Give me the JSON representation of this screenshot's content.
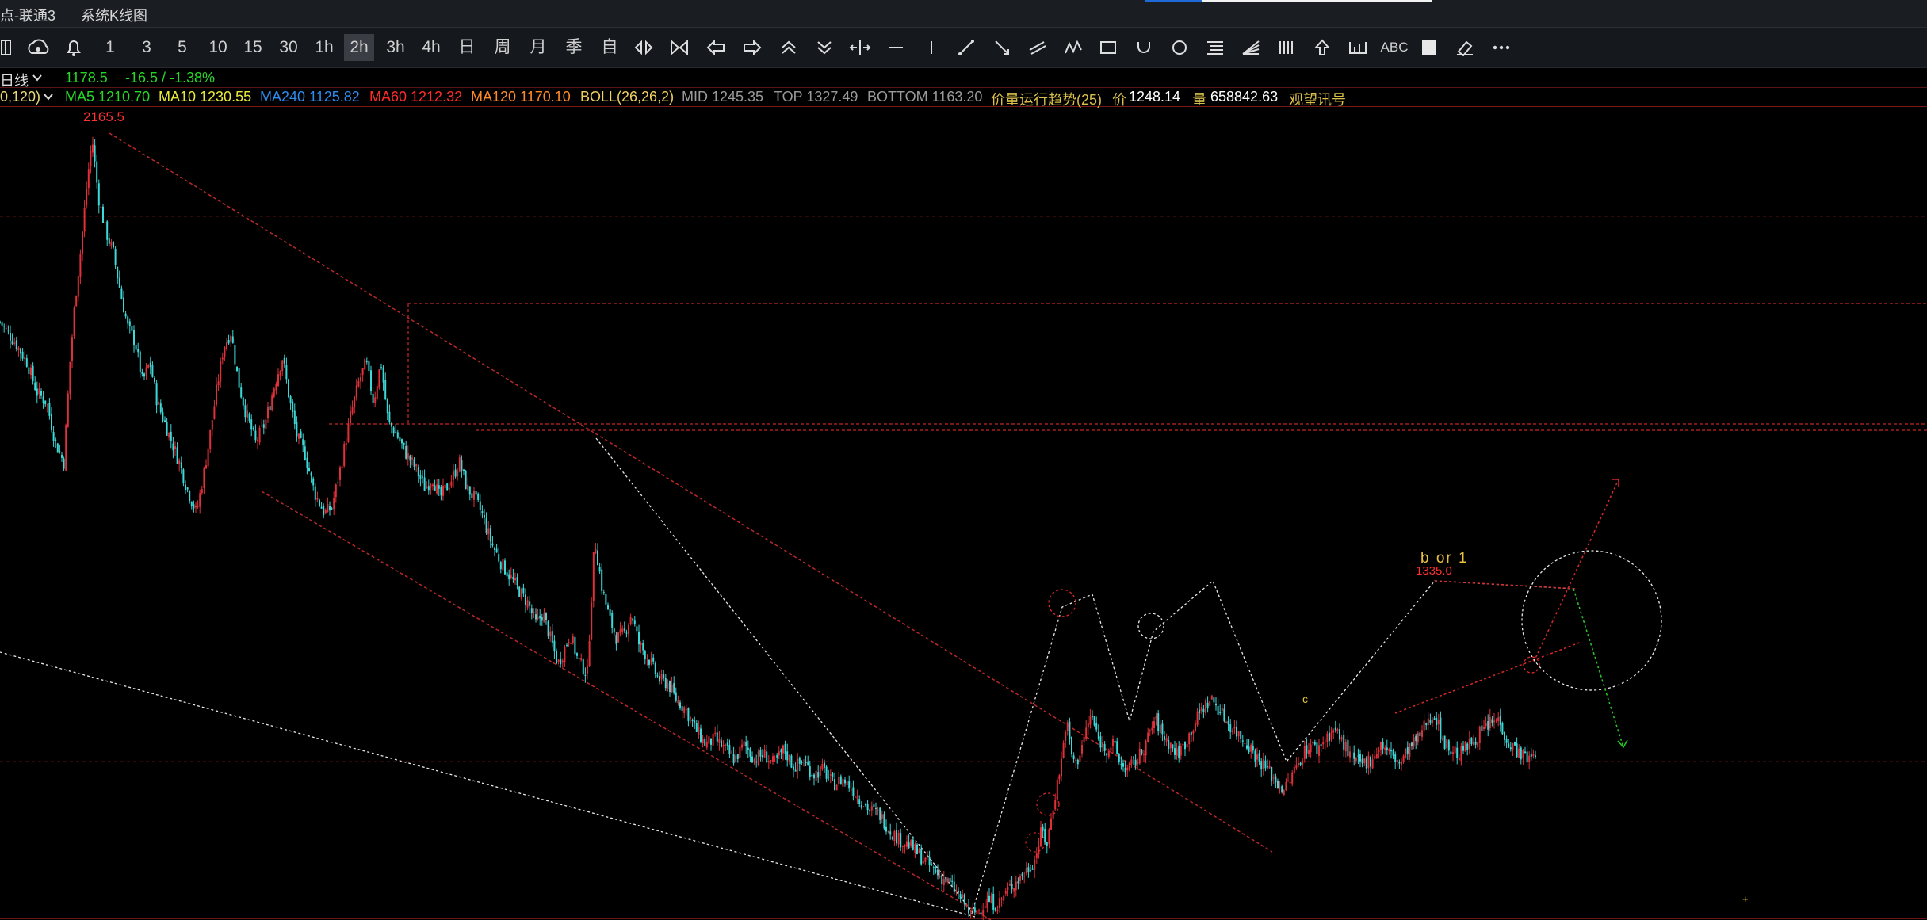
{
  "window": {
    "title_1": "点-联通3",
    "title_2": "系统K线图"
  },
  "toolbar": {
    "periods": [
      {
        "name": "period-1m",
        "label": "1"
      },
      {
        "name": "period-3m",
        "label": "3"
      },
      {
        "name": "period-5m",
        "label": "5"
      },
      {
        "name": "period-10m",
        "label": "10"
      },
      {
        "name": "period-15m",
        "label": "15"
      },
      {
        "name": "period-30m",
        "label": "30"
      },
      {
        "name": "period-1h",
        "label": "1h"
      },
      {
        "name": "period-2h",
        "label": "2h",
        "active": true
      },
      {
        "name": "period-3h",
        "label": "3h"
      },
      {
        "name": "period-4h",
        "label": "4h"
      },
      {
        "name": "period-day",
        "label": "日"
      },
      {
        "name": "period-week",
        "label": "周"
      },
      {
        "name": "period-month",
        "label": "月"
      },
      {
        "name": "period-season",
        "label": "季"
      },
      {
        "name": "period-custom",
        "label": "自"
      }
    ],
    "text_tool_label": "ABC"
  },
  "info": {
    "period_label": "日线",
    "last_price": "1178.5",
    "change": "-16.5 / -1.38%",
    "ma_params": "0,120)",
    "ma5": "MA5 1210.70",
    "ma10": "MA10 1230.55",
    "ma240": "MA240 1125.82",
    "ma60": "MA60 1212.32",
    "ma120": "MA120 1170.10",
    "boll": "BOLL(26,26,2)",
    "mid": "MID 1245.35",
    "top": "TOP 1327.49",
    "bottom": "BOTTOM 1163.20",
    "trend": "价量运行趋势(25)",
    "price_label": "价",
    "price_value": "1248.14",
    "volume_label": "量",
    "volume_value": "658842.63",
    "signal": "观望讯号"
  },
  "chart_data": {
    "type": "candlestick",
    "high_label": "2165.5",
    "recent_high_label": "1335.0",
    "wave_label": "b or 1",
    "colors": {
      "up": "#e0303a",
      "down": "#3fd8d8",
      "annotation": "#ff3030",
      "label_high": "#ff3030",
      "label_wave": "#e8c23c"
    },
    "close_path": [
      [
        0,
        1800
      ],
      [
        12,
        1760
      ],
      [
        22,
        1720
      ],
      [
        30,
        1660
      ],
      [
        38,
        1640
      ],
      [
        45,
        1560
      ],
      [
        52,
        1520
      ],
      [
        57,
        1720
      ],
      [
        61,
        1840
      ],
      [
        66,
        1950
      ],
      [
        71,
        2080
      ],
      [
        75,
        2165
      ],
      [
        80,
        2050
      ],
      [
        86,
        1980
      ],
      [
        92,
        1940
      ],
      [
        98,
        1860
      ],
      [
        104,
        1790
      ],
      [
        110,
        1760
      ],
      [
        116,
        1680
      ],
      [
        122,
        1720
      ],
      [
        128,
        1640
      ],
      [
        134,
        1600
      ],
      [
        140,
        1560
      ],
      [
        146,
        1520
      ],
      [
        152,
        1470
      ],
      [
        160,
        1420
      ],
      [
        166,
        1500
      ],
      [
        170,
        1560
      ],
      [
        176,
        1660
      ],
      [
        182,
        1750
      ],
      [
        188,
        1780
      ],
      [
        194,
        1680
      ],
      [
        200,
        1620
      ],
      [
        208,
        1560
      ],
      [
        216,
        1600
      ],
      [
        224,
        1680
      ],
      [
        230,
        1730
      ],
      [
        236,
        1640
      ],
      [
        242,
        1570
      ],
      [
        248,
        1540
      ],
      [
        256,
        1460
      ],
      [
        264,
        1420
      ],
      [
        270,
        1430
      ],
      [
        278,
        1520
      ],
      [
        285,
        1610
      ],
      [
        292,
        1680
      ],
      [
        298,
        1720
      ],
      [
        304,
        1640
      ],
      [
        310,
        1720
      ],
      [
        316,
        1600
      ],
      [
        322,
        1580
      ],
      [
        330,
        1540
      ],
      [
        338,
        1510
      ],
      [
        346,
        1470
      ],
      [
        352,
        1490
      ],
      [
        358,
        1450
      ],
      [
        366,
        1480
      ],
      [
        374,
        1520
      ],
      [
        380,
        1470
      ],
      [
        386,
        1450
      ],
      [
        392,
        1420
      ],
      [
        400,
        1360
      ],
      [
        408,
        1320
      ],
      [
        416,
        1290
      ],
      [
        424,
        1260
      ],
      [
        430,
        1240
      ],
      [
        436,
        1200
      ],
      [
        442,
        1220
      ],
      [
        448,
        1170
      ],
      [
        454,
        1120
      ],
      [
        458,
        1140
      ],
      [
        464,
        1180
      ],
      [
        470,
        1130
      ],
      [
        478,
        1100
      ],
      [
        484,
        1370
      ],
      [
        490,
        1270
      ],
      [
        496,
        1210
      ],
      [
        502,
        1170
      ],
      [
        508,
        1180
      ],
      [
        514,
        1220
      ],
      [
        520,
        1160
      ],
      [
        528,
        1130
      ],
      [
        536,
        1090
      ],
      [
        544,
        1080
      ],
      [
        550,
        1050
      ],
      [
        558,
        1030
      ],
      [
        566,
        990
      ],
      [
        574,
        960
      ],
      [
        582,
        970
      ],
      [
        590,
        950
      ],
      [
        598,
        930
      ],
      [
        606,
        960
      ],
      [
        614,
        930
      ],
      [
        622,
        940
      ],
      [
        630,
        920
      ],
      [
        638,
        950
      ],
      [
        646,
        915
      ],
      [
        654,
        925
      ],
      [
        662,
        900
      ],
      [
        670,
        910
      ],
      [
        678,
        880
      ],
      [
        686,
        890
      ],
      [
        694,
        870
      ],
      [
        700,
        850
      ],
      [
        708,
        830
      ],
      [
        716,
        820
      ],
      [
        724,
        790
      ],
      [
        732,
        770
      ],
      [
        740,
        760
      ],
      [
        748,
        740
      ],
      [
        756,
        720
      ],
      [
        764,
        700
      ],
      [
        772,
        685
      ],
      [
        780,
        660
      ],
      [
        786,
        640
      ],
      [
        790,
        620
      ],
      [
        796,
        630
      ],
      [
        804,
        650
      ],
      [
        812,
        640
      ],
      [
        820,
        670
      ],
      [
        828,
        690
      ],
      [
        836,
        710
      ],
      [
        842,
        730
      ],
      [
        848,
        790
      ],
      [
        852,
        760
      ],
      [
        858,
        850
      ],
      [
        864,
        930
      ],
      [
        868,
        1010
      ],
      [
        872,
        940
      ],
      [
        876,
        920
      ],
      [
        882,
        970
      ],
      [
        888,
        1020
      ],
      [
        894,
        970
      ],
      [
        900,
        950
      ],
      [
        906,
        960
      ],
      [
        912,
        920
      ],
      [
        918,
        910
      ],
      [
        926,
        930
      ],
      [
        934,
        970
      ],
      [
        940,
        1010
      ],
      [
        946,
        980
      ],
      [
        952,
        960
      ],
      [
        958,
        940
      ],
      [
        964,
        960
      ],
      [
        970,
        990
      ],
      [
        978,
        1030
      ],
      [
        986,
        1050
      ],
      [
        992,
        1030
      ],
      [
        1000,
        1000
      ],
      [
        1008,
        980
      ],
      [
        1016,
        960
      ],
      [
        1024,
        930
      ],
      [
        1032,
        910
      ],
      [
        1040,
        880
      ],
      [
        1046,
        870
      ],
      [
        1054,
        910
      ],
      [
        1060,
        940
      ],
      [
        1066,
        960
      ],
      [
        1072,
        950
      ],
      [
        1078,
        970
      ],
      [
        1086,
        990
      ],
      [
        1094,
        960
      ],
      [
        1100,
        930
      ],
      [
        1108,
        920
      ],
      [
        1116,
        930
      ],
      [
        1124,
        960
      ],
      [
        1132,
        940
      ],
      [
        1140,
        920
      ],
      [
        1146,
        950
      ],
      [
        1154,
        970
      ],
      [
        1162,
        1010
      ],
      [
        1168,
        1020
      ],
      [
        1174,
        970
      ],
      [
        1180,
        950
      ],
      [
        1188,
        940
      ],
      [
        1196,
        960
      ],
      [
        1204,
        980
      ],
      [
        1212,
        1000
      ],
      [
        1220,
        1010
      ],
      [
        1228,
        960
      ],
      [
        1234,
        950
      ],
      [
        1240,
        935
      ],
      [
        1246,
        930
      ],
      [
        1250,
        950
      ]
    ],
    "y_axis": {
      "min": 620,
      "max": 2180
    }
  }
}
